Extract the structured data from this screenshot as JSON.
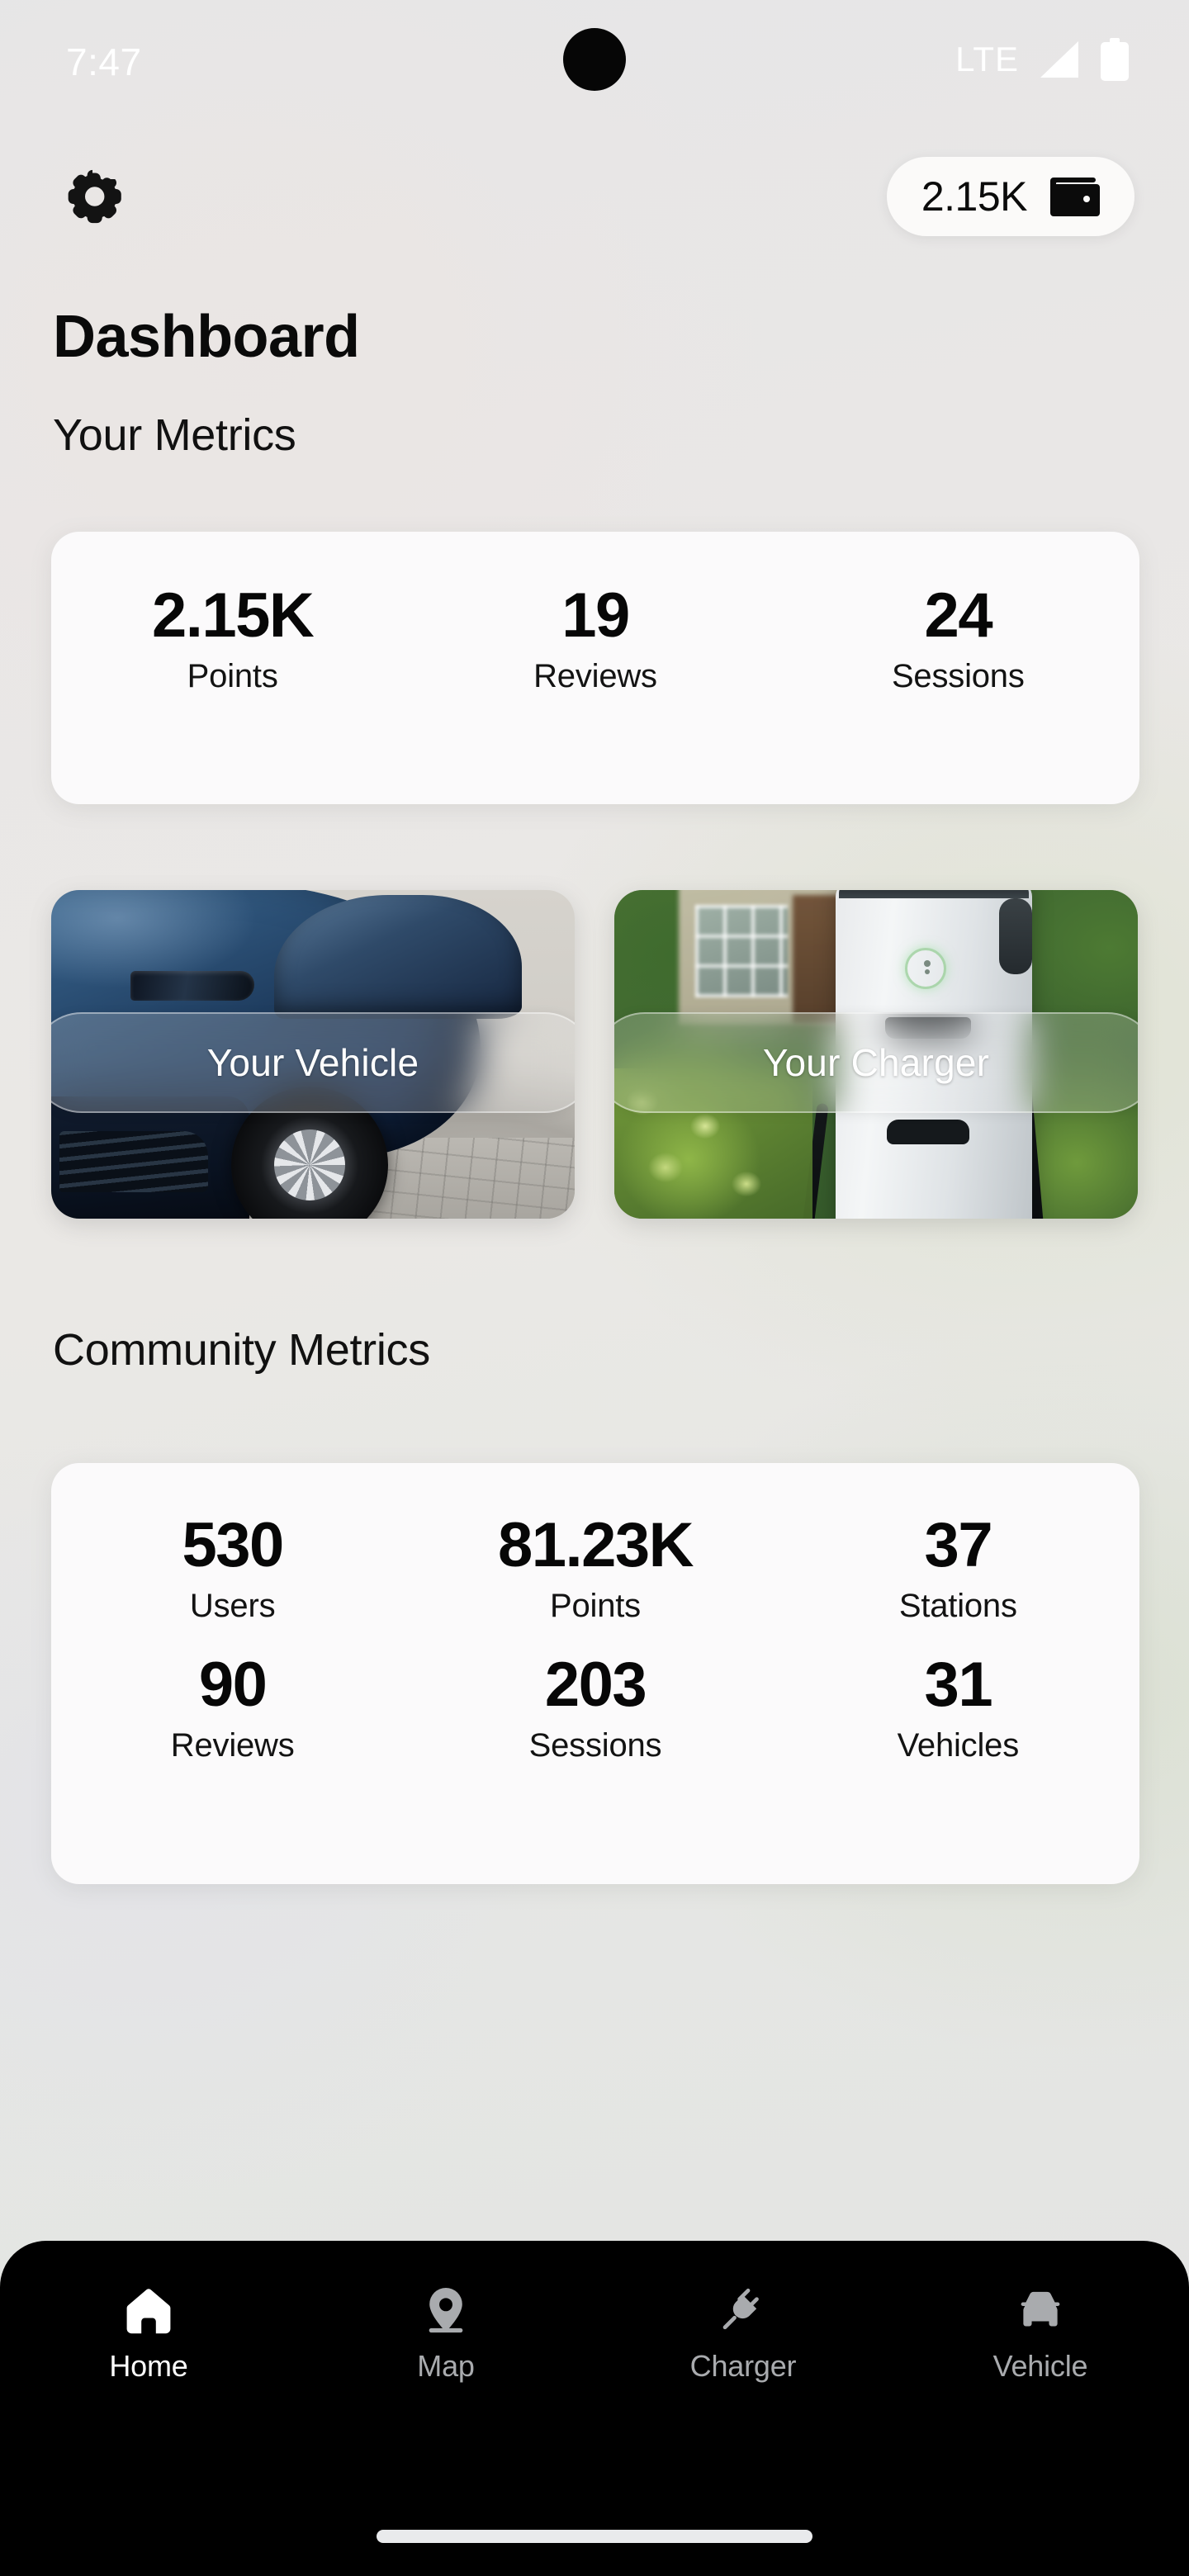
{
  "status_bar": {
    "time": "7:47",
    "network": "LTE",
    "signal_icon": "signal-bars-icon",
    "battery_icon": "battery-full-icon"
  },
  "top_bar": {
    "settings_icon": "gear-icon",
    "points_pill": {
      "value": "2.15K",
      "icon": "wallet-icon"
    }
  },
  "page": {
    "title": "Dashboard"
  },
  "your_metrics": {
    "heading": "Your Metrics",
    "items": [
      {
        "value": "2.15K",
        "label": "Points"
      },
      {
        "value": "19",
        "label": "Reviews"
      },
      {
        "value": "24",
        "label": "Sessions"
      }
    ]
  },
  "feature_cards": [
    {
      "label": "Your Vehicle",
      "image": "blue-electric-car-photo"
    },
    {
      "label": "Your Charger",
      "image": "ev-charging-station-photo"
    }
  ],
  "community_metrics": {
    "heading": "Community Metrics",
    "row1": [
      {
        "value": "530",
        "label": "Users"
      },
      {
        "value": "81.23K",
        "label": "Points"
      },
      {
        "value": "37",
        "label": "Stations"
      }
    ],
    "row2": [
      {
        "value": "90",
        "label": "Reviews"
      },
      {
        "value": "203",
        "label": "Sessions"
      },
      {
        "value": "31",
        "label": "Vehicles"
      }
    ]
  },
  "bottom_nav": {
    "items": [
      {
        "label": "Home",
        "icon": "home-icon",
        "active": true
      },
      {
        "label": "Map",
        "icon": "map-pin-icon",
        "active": false
      },
      {
        "label": "Charger",
        "icon": "plug-icon",
        "active": false
      },
      {
        "label": "Vehicle",
        "icon": "car-icon",
        "active": false
      }
    ]
  },
  "colors": {
    "background": "#e7e7e6",
    "card_background": "#fbfafb",
    "nav_background": "#000000",
    "text_primary": "#0a0a0a",
    "nav_active": "#ffffff",
    "nav_inactive": "#a9abae",
    "status_text": "#ffffff"
  }
}
